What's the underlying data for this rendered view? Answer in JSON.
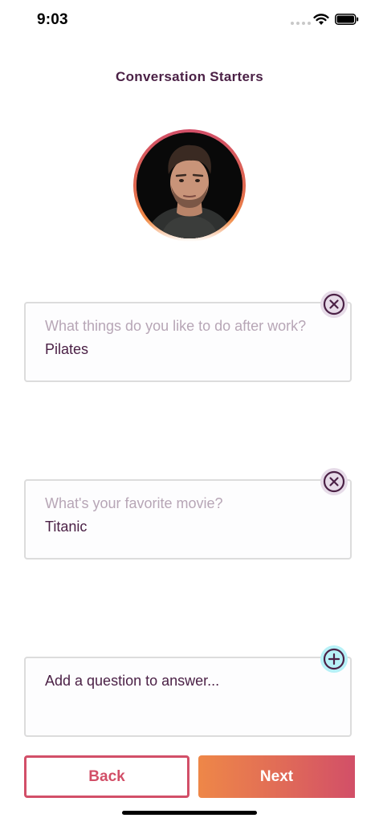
{
  "status_bar": {
    "time": "9:03"
  },
  "header": {
    "title": "Conversation Starters"
  },
  "avatar": {
    "icon": "profile-photo"
  },
  "prompts": [
    {
      "question": "What things do you like to do after work?",
      "answer": "Pilates",
      "action_icon": "close-circle-icon"
    },
    {
      "question": "What's your favorite movie?",
      "answer": "Titanic",
      "action_icon": "close-circle-icon"
    }
  ],
  "add_prompt": {
    "placeholder": "Add a question to answer...",
    "action_icon": "plus-circle-icon"
  },
  "footer": {
    "back_label": "Back",
    "next_label": "Next"
  },
  "colors": {
    "primary_text": "#4b2146",
    "muted_text": "#b7a6b6",
    "accent_pink": "#d24f68",
    "accent_orange": "#ee8748",
    "add_icon_bg": "#b7f1f7"
  }
}
